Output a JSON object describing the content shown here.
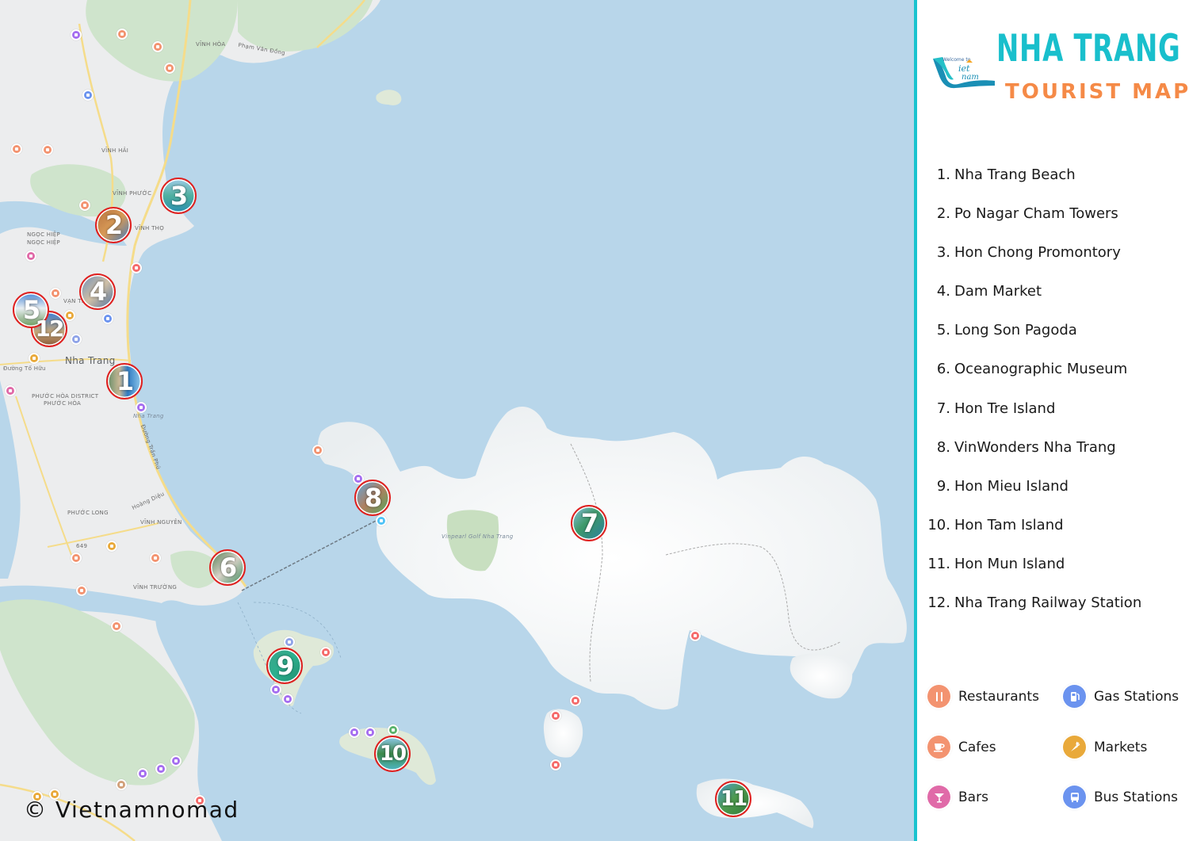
{
  "header": {
    "logo_text_top": "Welcome to",
    "logo_text_main": "Vietnam",
    "title_line1": "NHA TRANG",
    "title_line2": "TOURIST MAP"
  },
  "places": [
    {
      "num": "1.",
      "name": "Nha Trang Beach",
      "marker": "1"
    },
    {
      "num": "2.",
      "name": "Po Nagar Cham Towers",
      "marker": "2"
    },
    {
      "num": "3.",
      "name": "Hon Chong Promontory",
      "marker": "3"
    },
    {
      "num": "4.",
      "name": "Dam Market",
      "marker": "4"
    },
    {
      "num": "5.",
      "name": "Long Son Pagoda",
      "marker": "5"
    },
    {
      "num": "6.",
      "name": "Oceanographic Museum",
      "marker": "6"
    },
    {
      "num": "7.",
      "name": "Hon Tre Island",
      "marker": "7"
    },
    {
      "num": "8.",
      "name": "VinWonders Nha Trang",
      "marker": "8"
    },
    {
      "num": "9.",
      "name": "Hon Mieu Island",
      "marker": "9"
    },
    {
      "num": "10.",
      "name": "Hon Tam Island",
      "marker": "10"
    },
    {
      "num": "11.",
      "name": "Hon Mun Island",
      "marker": "11"
    },
    {
      "num": "12.",
      "name": "Nha Trang Railway Station",
      "marker": "12"
    }
  ],
  "legend": [
    {
      "label": "Restaurants",
      "icon": "fork-knife-icon",
      "glyph": "🍴",
      "color": "#f39370"
    },
    {
      "label": "Gas Stations",
      "icon": "fuel-pump-icon",
      "glyph": "⛽",
      "color": "#6b93ef"
    },
    {
      "label": "Cafes",
      "icon": "coffee-cup-icon",
      "glyph": "☕",
      "color": "#f39370"
    },
    {
      "label": "Markets",
      "icon": "carrot-icon",
      "glyph": "🥕",
      "color": "#e9a93a"
    },
    {
      "label": "Bars",
      "icon": "cocktail-icon",
      "glyph": "🍸",
      "color": "#e06aa8"
    },
    {
      "label": "Bus Stations",
      "icon": "bus-icon",
      "glyph": "🚌",
      "color": "#6b93ef"
    }
  ],
  "map_labels": {
    "vinh_hoa": "VĨNH HÒA",
    "pham_van_dong": "Phạm Văn Đồng",
    "vinh_hai": "VĨNH HẢI",
    "vinh_phuoc": "VĨNH PHƯỚC",
    "vinh_tho": "VĨNH THỌ",
    "ngoc_hiep1": "NGỌC HIỆP",
    "ngoc_hiep2": "NGỌC HIỆP",
    "van_thang": "VẠN THẠNH",
    "city": "Nha Trang",
    "duong_to_huu": "Đường Tố Hữu",
    "phuoc_hoa_district": "PHƯỚC HÒA DISTRICT",
    "phuoc_hoa": "PHƯỚC HÒA",
    "nha_trang_beach_label": "Nha Trang",
    "duong_tran_phu": "Đường Trần Phú",
    "phuoc_long": "PHƯỚC LONG",
    "vinh_nguyen": "VĨNH NGUYÊN",
    "hoang_dieu": "Hoàng Diệu",
    "vinh_truong": "VĨNH TRƯỜNG",
    "road_649": "649",
    "golf": "Vinpearl Golf Nha Trang"
  },
  "colors": {
    "sea": "#b8d6ea",
    "accent_teal": "#19bfcc",
    "accent_orange": "#f58a47",
    "marker_ring": "#e0201f"
  },
  "copyright": "© Vietnamnomad"
}
